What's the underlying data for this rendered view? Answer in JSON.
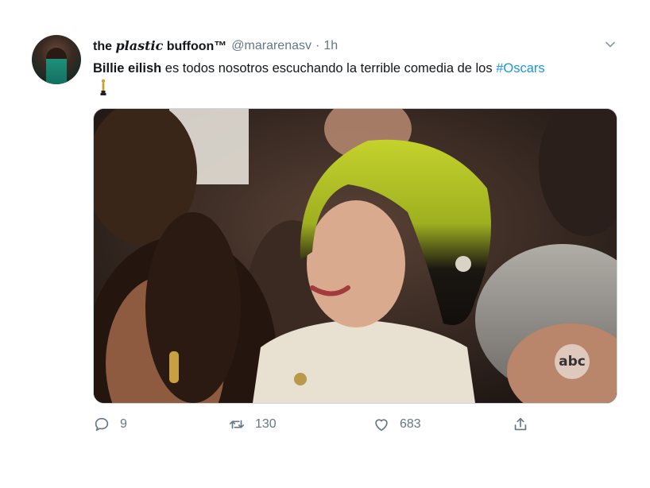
{
  "tweet": {
    "display_name_plain": "the ",
    "display_name_fancy": "plastic",
    "display_name_rest": " buffoon™",
    "handle": "@mararenasv",
    "separator": "·",
    "time": "1h",
    "text": {
      "bold": "Billie eilish",
      "body": " es todos nosotros escuchando la terrible comedia de los ",
      "hashtag": "#Oscars"
    },
    "emoji_icon": "oscar-trophy-icon",
    "media_watermark": "abc"
  },
  "actions": {
    "reply_count": "9",
    "retweet_count": "130",
    "like_count": "683"
  },
  "colors": {
    "link": "#1b95e0",
    "muted": "#657786",
    "text": "#14171a"
  }
}
